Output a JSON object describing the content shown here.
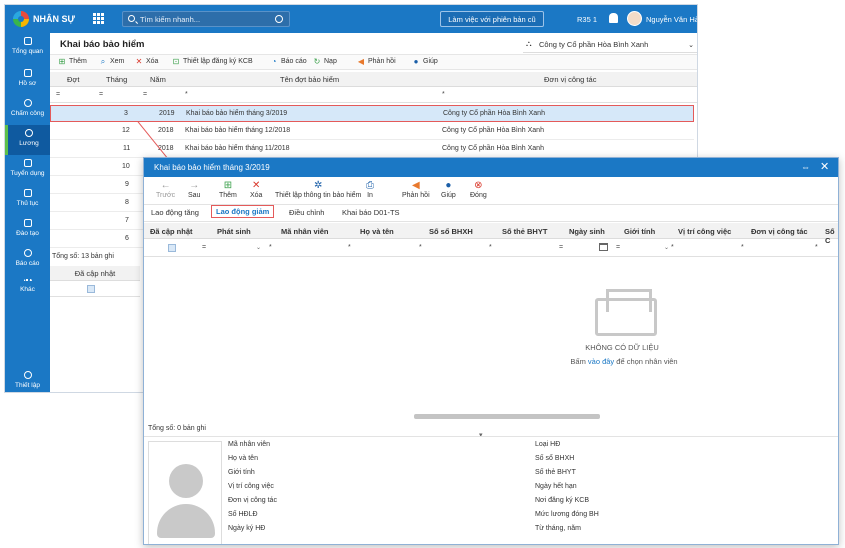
{
  "app": {
    "brand": "NHÂN SỰ",
    "search_placeholder": "Tìm kiếm nhanh...",
    "old_session_button": "Làm việc với phiên bản cũ",
    "org_code": "R35 1",
    "user_name": "Nguyễn Văn Hà",
    "accent": "#1b78c5"
  },
  "sidebar": [
    {
      "label": "Tổng quan",
      "icon": "home-icon"
    },
    {
      "label": "Hồ sơ",
      "icon": "user-icon"
    },
    {
      "label": "Chấm công",
      "icon": "clock-icon"
    },
    {
      "label": "Lương",
      "icon": "money-icon",
      "active": true
    },
    {
      "label": "Tuyển dụng",
      "icon": "recruit-icon"
    },
    {
      "label": "Thủ tục",
      "icon": "procedure-icon"
    },
    {
      "label": "Đào tạo",
      "icon": "training-icon"
    },
    {
      "label": "Báo cáo",
      "icon": "report-icon"
    },
    {
      "label": "Khác",
      "icon": "more-icon"
    },
    {
      "label": "Thiết lập",
      "icon": "settings-icon"
    }
  ],
  "main": {
    "title": "Khai báo bảo hiểm",
    "company": "Công ty Cổ phần Hòa Bình Xanh",
    "toolbar": [
      "Thêm",
      "Xem",
      "Xóa",
      "Thiết lập đăng ký KCB",
      "Báo cáo",
      "Nạp",
      "Phản hồi",
      "Giúp"
    ],
    "columns": [
      "Đợt",
      "Tháng",
      "Năm",
      "Tên đợt bảo hiểm",
      "Đơn vị công tác"
    ],
    "filters": [
      "=",
      "=",
      "=",
      "*",
      "*"
    ],
    "rows": [
      {
        "dot": "",
        "thang": "3",
        "nam": "2019",
        "ten": "Khai báo bảo hiểm tháng 3/2019",
        "donvi": "Công ty Cổ phần Hòa Bình Xanh"
      },
      {
        "dot": "",
        "thang": "12",
        "nam": "2018",
        "ten": "Khai báo bảo hiểm tháng 12/2018",
        "donvi": "Công ty Cổ phần Hòa Bình Xanh"
      },
      {
        "dot": "",
        "thang": "11",
        "nam": "2018",
        "ten": "Khai báo bảo hiểm tháng 11/2018",
        "donvi": "Công ty Cổ phần Hòa Bình Xanh"
      },
      {
        "dot": "",
        "thang": "10",
        "nam": "",
        "ten": "",
        "donvi": ""
      },
      {
        "dot": "",
        "thang": "9",
        "nam": "",
        "ten": "",
        "donvi": ""
      },
      {
        "dot": "",
        "thang": "8",
        "nam": "",
        "ten": "",
        "donvi": ""
      },
      {
        "dot": "",
        "thang": "7",
        "nam": "",
        "ten": "",
        "donvi": ""
      },
      {
        "dot": "",
        "thang": "6",
        "nam": "",
        "ten": "",
        "donvi": ""
      }
    ],
    "total": "Tổng số: 13 bản ghi",
    "updated_col": "Đã cập nhật"
  },
  "dialog": {
    "title": "Khai báo bảo hiểm tháng 3/2019",
    "toolbar": [
      {
        "label": "Trước",
        "icon": "back-arrow-icon"
      },
      {
        "label": "Sau",
        "icon": "forward-arrow-icon"
      },
      {
        "label": "Thêm",
        "icon": "add-icon"
      },
      {
        "label": "Xóa",
        "icon": "delete-icon"
      },
      {
        "label": "Thiết lập thông tin bảo hiểm",
        "icon": "gear-icon"
      },
      {
        "label": "In",
        "icon": "print-icon"
      },
      {
        "label": "Phản hồi",
        "icon": "feedback-icon"
      },
      {
        "label": "Giúp",
        "icon": "help-icon"
      },
      {
        "label": "Đóng",
        "icon": "close-circle-icon"
      }
    ],
    "tabs": [
      "Lao động tăng",
      "Lao động giảm",
      "Điều chỉnh",
      "Khai báo D01-TS"
    ],
    "active_tab": "Lao động giảm",
    "columns": [
      "Đã cập nhật",
      "Phát sinh",
      "Mã nhân viên",
      "Họ và tên",
      "Số sổ BHXH",
      "Số thẻ BHYT",
      "Ngày sinh",
      "Giới tính",
      "Vị trí công việc",
      "Đơn vị công tác",
      "Số C"
    ],
    "filter_ops": [
      "=",
      "*",
      "*",
      "*",
      "*",
      "=",
      "=",
      "*",
      "*",
      "*"
    ],
    "empty_title": "KHÔNG CÓ DỮ LIỆU",
    "empty_hint_pre": "Bấm",
    "empty_hint_link": "vào đây",
    "empty_hint_post": "để chọn nhân viên",
    "total": "Tổng số: 0 bản ghi",
    "detail_left": [
      "Mã nhân viên",
      "Họ và tên",
      "Giới tính",
      "Vị trí công việc",
      "Đơn vị công tác",
      "Số HĐLĐ",
      "Ngày ký HĐ"
    ],
    "detail_right": [
      "Loại HĐ",
      "Số sổ BHXH",
      "Số thẻ BHYT",
      "Ngày hết hạn",
      "Nơi đăng ký KCB",
      "Mức lương đóng BH",
      "Từ tháng, năm"
    ]
  }
}
